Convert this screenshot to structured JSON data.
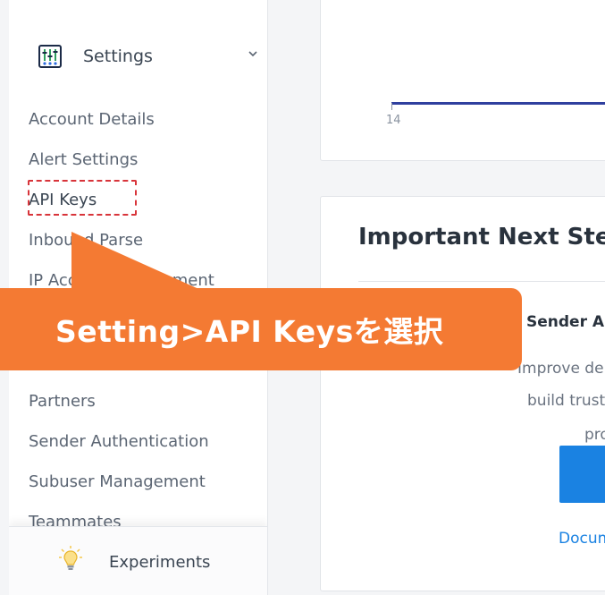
{
  "sidebar": {
    "section_label": "Settings",
    "items": [
      {
        "label": "Account Details"
      },
      {
        "label": "Alert Settings"
      },
      {
        "label": "API Keys"
      },
      {
        "label": "Inbound Parse"
      },
      {
        "label": "IP Access Management"
      },
      {
        "label": "Partners"
      },
      {
        "label": "Sender Authentication"
      },
      {
        "label": "Subuser Management"
      },
      {
        "label": "Teammates"
      }
    ],
    "footer_label": "Experiments"
  },
  "chart": {
    "tick_label": "14"
  },
  "next_steps": {
    "title": "Important Next Steps",
    "item_title": "Sender Authentication",
    "text_lines": [
      "Improve deliverability",
      "build trust",
      "pro"
    ],
    "link": "Documentation"
  },
  "callout": {
    "text": "Setting>API Keysを選択"
  },
  "colors": {
    "accent": "#1a82e2",
    "callout": "#f47a33",
    "highlight": "#d8343a"
  }
}
